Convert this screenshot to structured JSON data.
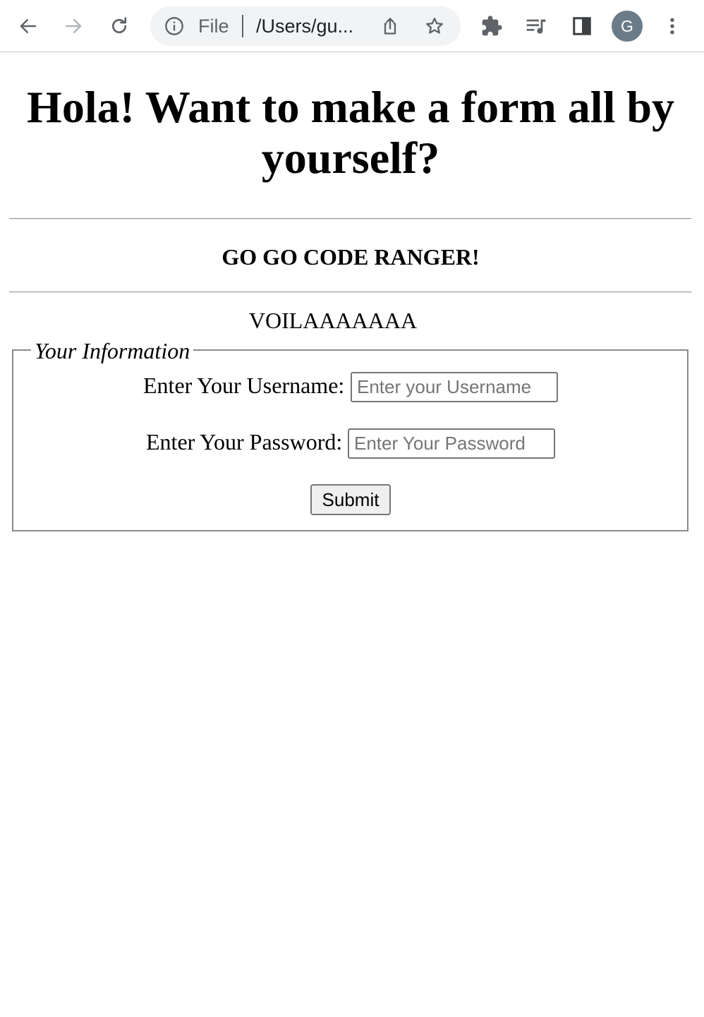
{
  "browser": {
    "address_scheme": "File",
    "address_url": "/Users/gu...",
    "profile_initial": "G",
    "icons": {
      "back": "back-arrow-icon",
      "forward": "forward-arrow-icon",
      "reload": "reload-icon",
      "site_info": "info-icon",
      "share": "share-icon",
      "bookmark": "star-icon",
      "extensions": "puzzle-icon",
      "media": "media-queue-icon",
      "side_panel": "side-panel-icon",
      "menu": "more-vertical-icon"
    }
  },
  "page": {
    "heading": "Hola! Want to make a form all by yourself?",
    "subheading": "GO GO CODE RANGER!",
    "tagline": "VOILAAAAAAA",
    "form": {
      "legend": "Your Information",
      "username_label": "Enter Your Username:",
      "username_placeholder": "Enter your Username",
      "username_value": "",
      "password_label": "Enter Your Password:",
      "password_placeholder": "Enter Your Password",
      "password_value": "",
      "submit_label": "Submit"
    }
  }
}
